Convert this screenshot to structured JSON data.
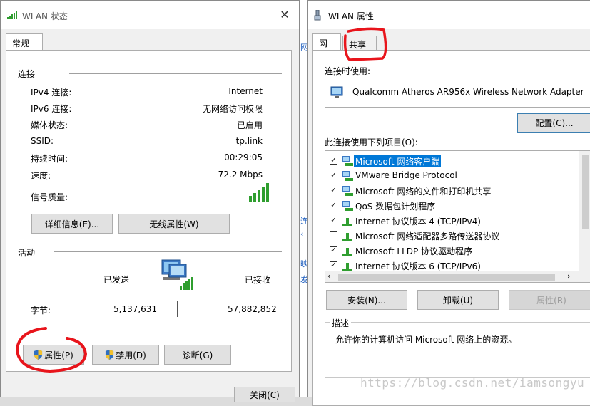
{
  "status_window": {
    "title": "WLAN 状态",
    "tab": "常规",
    "connection_section": "连接",
    "rows": [
      {
        "label": "IPv4 连接:",
        "value": "Internet"
      },
      {
        "label": "IPv6 连接:",
        "value": "无网络访问权限"
      },
      {
        "label": "媒体状态:",
        "value": "已启用"
      },
      {
        "label": "SSID:",
        "value": "tp.link"
      },
      {
        "label": "持续时间:",
        "value": "00:29:05"
      },
      {
        "label": "速度:",
        "value": "72.2 Mbps"
      },
      {
        "label": "信号质量:",
        "value": ""
      }
    ],
    "details_button": "详细信息(E)...",
    "wireless_props_button": "无线属性(W)",
    "activity_section": "活动",
    "sent_label": "已发送",
    "received_label": "已接收",
    "bytes_label": "字节:",
    "bytes_sent": "5,137,631",
    "bytes_received": "57,882,852",
    "properties_button": "属性(P)",
    "disable_button": "禁用(D)",
    "diagnose_button": "诊断(G)",
    "close_button": "关闭(C)"
  },
  "props_window": {
    "title": "WLAN 属性",
    "tabs": [
      "网络",
      "共享"
    ],
    "connect_using_label": "连接时使用:",
    "adapter_name": "Qualcomm Atheros AR956x Wireless Network Adapter",
    "configure_button": "配置(C)...",
    "items_label": "此连接使用下列项目(O):",
    "items": [
      {
        "label": "Microsoft 网络客户端",
        "checked": true,
        "selected": true,
        "icon": "network-client-icon"
      },
      {
        "label": "VMware Bridge Protocol",
        "checked": true,
        "selected": false,
        "icon": "network-client-icon"
      },
      {
        "label": "Microsoft 网络的文件和打印机共享",
        "checked": true,
        "selected": false,
        "icon": "network-client-icon"
      },
      {
        "label": "QoS 数据包计划程序",
        "checked": true,
        "selected": false,
        "icon": "network-client-icon"
      },
      {
        "label": "Internet 协议版本 4 (TCP/IPv4)",
        "checked": true,
        "selected": false,
        "icon": "protocol-icon"
      },
      {
        "label": "Microsoft 网络适配器多路传送器协议",
        "checked": false,
        "selected": false,
        "icon": "protocol-icon"
      },
      {
        "label": "Microsoft LLDP 协议驱动程序",
        "checked": true,
        "selected": false,
        "icon": "protocol-icon"
      },
      {
        "label": "Internet 协议版本 6 (TCP/IPv6)",
        "checked": true,
        "selected": false,
        "icon": "protocol-icon"
      }
    ],
    "install_button": "安装(N)...",
    "uninstall_button": "卸载(U)",
    "properties_button": "属性(R)",
    "description_label": "描述",
    "description_text": "允许你的计算机访问 Microsoft 网络上的资源。"
  },
  "watermark": "https://blog.csdn.net/iamsongyu",
  "colors": {
    "selection": "#0078d7",
    "annotation": "#e8141b",
    "signal": "#2f9e2f"
  }
}
